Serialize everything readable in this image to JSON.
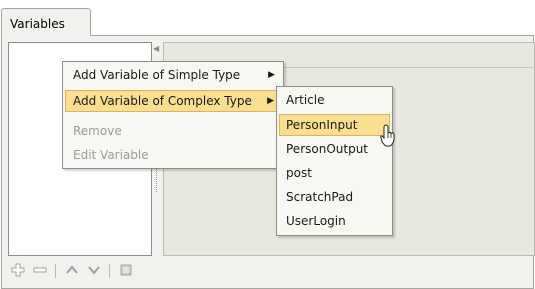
{
  "tab": {
    "label": "Variables"
  },
  "context_menu": {
    "items": [
      {
        "label": "Add Variable of Simple Type",
        "submenu": true,
        "enabled": true
      },
      {
        "label": "Add Variable of Complex Type",
        "submenu": true,
        "enabled": true,
        "highlighted": true
      },
      {
        "label": "Remove",
        "enabled": false
      },
      {
        "label": "Edit Variable",
        "enabled": false
      }
    ]
  },
  "complex_type_submenu": {
    "items": [
      {
        "label": "Article"
      },
      {
        "label": "PersonInput",
        "highlighted": true
      },
      {
        "label": "PersonOutput"
      },
      {
        "label": "post"
      },
      {
        "label": "ScratchPad"
      },
      {
        "label": "UserLogin"
      }
    ]
  },
  "toolbar": {
    "icons": [
      "add-icon",
      "remove-icon",
      "move-up-icon",
      "move-down-icon",
      "delete-icon"
    ]
  },
  "colors": {
    "highlight": "#fbdf90",
    "highlight_border": "#e0b55a",
    "panel": "#f2f1ed",
    "disabled_text": "#9d9d97"
  }
}
